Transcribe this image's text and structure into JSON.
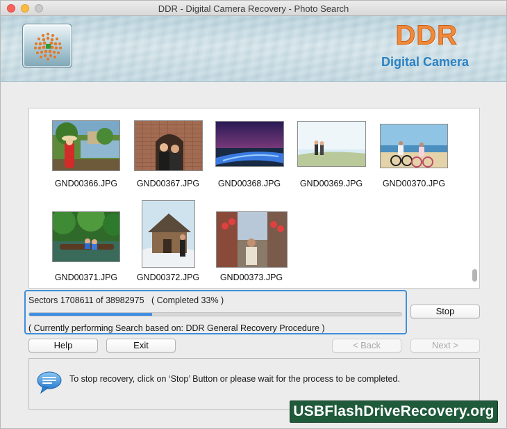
{
  "window": {
    "title": "DDR - Digital Camera Recovery - Photo Search"
  },
  "header": {
    "brand": "DDR",
    "subtitle": "Digital Camera",
    "logo_icon": "dotted-sphere-icon"
  },
  "thumbnails": [
    {
      "label": "GND00366.JPG"
    },
    {
      "label": "GND00367.JPG"
    },
    {
      "label": "GND00368.JPG"
    },
    {
      "label": "GND00369.JPG"
    },
    {
      "label": "GND00370.JPG"
    },
    {
      "label": "GND00371.JPG"
    },
    {
      "label": "GND00372.JPG"
    },
    {
      "label": "GND00373.JPG"
    }
  ],
  "progress": {
    "status_text": "Sectors 1708611 of 38982975   ( Completed 33% )",
    "percent": 33,
    "procedure_text": "( Currently performing Search based on: DDR General Recovery Procedure )"
  },
  "buttons": {
    "stop": "Stop",
    "help": "Help",
    "exit": "Exit",
    "back": "< Back",
    "next": "Next >"
  },
  "info": {
    "icon": "speech-bubble-icon",
    "message": "To stop recovery, click on ‘Stop’ Button or please wait for the process to be completed."
  },
  "watermark": "USBFlashDriveRecovery.org",
  "colors": {
    "accent": "#3d8fd8",
    "brand_orange": "#f08a3a",
    "brand_blue": "#2a82c4",
    "watermark_bg": "#1f5a3a"
  }
}
